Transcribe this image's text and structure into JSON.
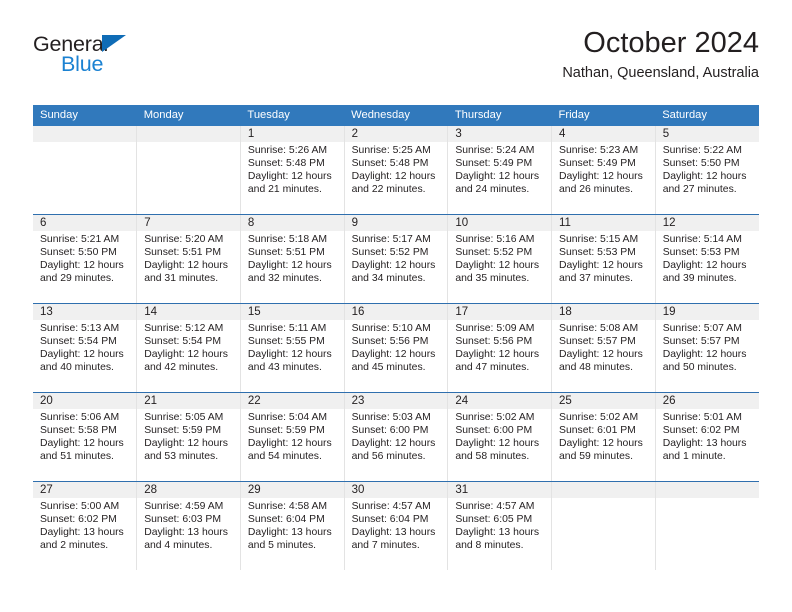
{
  "brand": {
    "name_top": "General",
    "name_bottom": "Blue",
    "triangle_color": "#0f6cb6",
    "blue_text_color": "#1b82d2"
  },
  "header": {
    "title": "October 2024",
    "location": "Nathan, Queensland, Australia"
  },
  "theme": {
    "header_blue": "#3179bc",
    "row_divider_blue": "#2f6fae",
    "daynum_band": "#f0f0f0",
    "text": "#231f20"
  },
  "weekday_headers": [
    "Sunday",
    "Monday",
    "Tuesday",
    "Wednesday",
    "Thursday",
    "Friday",
    "Saturday"
  ],
  "weeks": [
    [
      {
        "empty": true
      },
      {
        "empty": true
      },
      {
        "day": "1",
        "sunrise": "Sunrise: 5:26 AM",
        "sunset": "Sunset: 5:48 PM",
        "daylight1": "Daylight: 12 hours",
        "daylight2": "and 21 minutes."
      },
      {
        "day": "2",
        "sunrise": "Sunrise: 5:25 AM",
        "sunset": "Sunset: 5:48 PM",
        "daylight1": "Daylight: 12 hours",
        "daylight2": "and 22 minutes."
      },
      {
        "day": "3",
        "sunrise": "Sunrise: 5:24 AM",
        "sunset": "Sunset: 5:49 PM",
        "daylight1": "Daylight: 12 hours",
        "daylight2": "and 24 minutes."
      },
      {
        "day": "4",
        "sunrise": "Sunrise: 5:23 AM",
        "sunset": "Sunset: 5:49 PM",
        "daylight1": "Daylight: 12 hours",
        "daylight2": "and 26 minutes."
      },
      {
        "day": "5",
        "sunrise": "Sunrise: 5:22 AM",
        "sunset": "Sunset: 5:50 PM",
        "daylight1": "Daylight: 12 hours",
        "daylight2": "and 27 minutes."
      }
    ],
    [
      {
        "day": "6",
        "sunrise": "Sunrise: 5:21 AM",
        "sunset": "Sunset: 5:50 PM",
        "daylight1": "Daylight: 12 hours",
        "daylight2": "and 29 minutes."
      },
      {
        "day": "7",
        "sunrise": "Sunrise: 5:20 AM",
        "sunset": "Sunset: 5:51 PM",
        "daylight1": "Daylight: 12 hours",
        "daylight2": "and 31 minutes."
      },
      {
        "day": "8",
        "sunrise": "Sunrise: 5:18 AM",
        "sunset": "Sunset: 5:51 PM",
        "daylight1": "Daylight: 12 hours",
        "daylight2": "and 32 minutes."
      },
      {
        "day": "9",
        "sunrise": "Sunrise: 5:17 AM",
        "sunset": "Sunset: 5:52 PM",
        "daylight1": "Daylight: 12 hours",
        "daylight2": "and 34 minutes."
      },
      {
        "day": "10",
        "sunrise": "Sunrise: 5:16 AM",
        "sunset": "Sunset: 5:52 PM",
        "daylight1": "Daylight: 12 hours",
        "daylight2": "and 35 minutes."
      },
      {
        "day": "11",
        "sunrise": "Sunrise: 5:15 AM",
        "sunset": "Sunset: 5:53 PM",
        "daylight1": "Daylight: 12 hours",
        "daylight2": "and 37 minutes."
      },
      {
        "day": "12",
        "sunrise": "Sunrise: 5:14 AM",
        "sunset": "Sunset: 5:53 PM",
        "daylight1": "Daylight: 12 hours",
        "daylight2": "and 39 minutes."
      }
    ],
    [
      {
        "day": "13",
        "sunrise": "Sunrise: 5:13 AM",
        "sunset": "Sunset: 5:54 PM",
        "daylight1": "Daylight: 12 hours",
        "daylight2": "and 40 minutes."
      },
      {
        "day": "14",
        "sunrise": "Sunrise: 5:12 AM",
        "sunset": "Sunset: 5:54 PM",
        "daylight1": "Daylight: 12 hours",
        "daylight2": "and 42 minutes."
      },
      {
        "day": "15",
        "sunrise": "Sunrise: 5:11 AM",
        "sunset": "Sunset: 5:55 PM",
        "daylight1": "Daylight: 12 hours",
        "daylight2": "and 43 minutes."
      },
      {
        "day": "16",
        "sunrise": "Sunrise: 5:10 AM",
        "sunset": "Sunset: 5:56 PM",
        "daylight1": "Daylight: 12 hours",
        "daylight2": "and 45 minutes."
      },
      {
        "day": "17",
        "sunrise": "Sunrise: 5:09 AM",
        "sunset": "Sunset: 5:56 PM",
        "daylight1": "Daylight: 12 hours",
        "daylight2": "and 47 minutes."
      },
      {
        "day": "18",
        "sunrise": "Sunrise: 5:08 AM",
        "sunset": "Sunset: 5:57 PM",
        "daylight1": "Daylight: 12 hours",
        "daylight2": "and 48 minutes."
      },
      {
        "day": "19",
        "sunrise": "Sunrise: 5:07 AM",
        "sunset": "Sunset: 5:57 PM",
        "daylight1": "Daylight: 12 hours",
        "daylight2": "and 50 minutes."
      }
    ],
    [
      {
        "day": "20",
        "sunrise": "Sunrise: 5:06 AM",
        "sunset": "Sunset: 5:58 PM",
        "daylight1": "Daylight: 12 hours",
        "daylight2": "and 51 minutes."
      },
      {
        "day": "21",
        "sunrise": "Sunrise: 5:05 AM",
        "sunset": "Sunset: 5:59 PM",
        "daylight1": "Daylight: 12 hours",
        "daylight2": "and 53 minutes."
      },
      {
        "day": "22",
        "sunrise": "Sunrise: 5:04 AM",
        "sunset": "Sunset: 5:59 PM",
        "daylight1": "Daylight: 12 hours",
        "daylight2": "and 54 minutes."
      },
      {
        "day": "23",
        "sunrise": "Sunrise: 5:03 AM",
        "sunset": "Sunset: 6:00 PM",
        "daylight1": "Daylight: 12 hours",
        "daylight2": "and 56 minutes."
      },
      {
        "day": "24",
        "sunrise": "Sunrise: 5:02 AM",
        "sunset": "Sunset: 6:00 PM",
        "daylight1": "Daylight: 12 hours",
        "daylight2": "and 58 minutes."
      },
      {
        "day": "25",
        "sunrise": "Sunrise: 5:02 AM",
        "sunset": "Sunset: 6:01 PM",
        "daylight1": "Daylight: 12 hours",
        "daylight2": "and 59 minutes."
      },
      {
        "day": "26",
        "sunrise": "Sunrise: 5:01 AM",
        "sunset": "Sunset: 6:02 PM",
        "daylight1": "Daylight: 13 hours",
        "daylight2": "and 1 minute."
      }
    ],
    [
      {
        "day": "27",
        "sunrise": "Sunrise: 5:00 AM",
        "sunset": "Sunset: 6:02 PM",
        "daylight1": "Daylight: 13 hours",
        "daylight2": "and 2 minutes."
      },
      {
        "day": "28",
        "sunrise": "Sunrise: 4:59 AM",
        "sunset": "Sunset: 6:03 PM",
        "daylight1": "Daylight: 13 hours",
        "daylight2": "and 4 minutes."
      },
      {
        "day": "29",
        "sunrise": "Sunrise: 4:58 AM",
        "sunset": "Sunset: 6:04 PM",
        "daylight1": "Daylight: 13 hours",
        "daylight2": "and 5 minutes."
      },
      {
        "day": "30",
        "sunrise": "Sunrise: 4:57 AM",
        "sunset": "Sunset: 6:04 PM",
        "daylight1": "Daylight: 13 hours",
        "daylight2": "and 7 minutes."
      },
      {
        "day": "31",
        "sunrise": "Sunrise: 4:57 AM",
        "sunset": "Sunset: 6:05 PM",
        "daylight1": "Daylight: 13 hours",
        "daylight2": "and 8 minutes."
      },
      {
        "empty": true
      },
      {
        "empty": true
      }
    ]
  ]
}
